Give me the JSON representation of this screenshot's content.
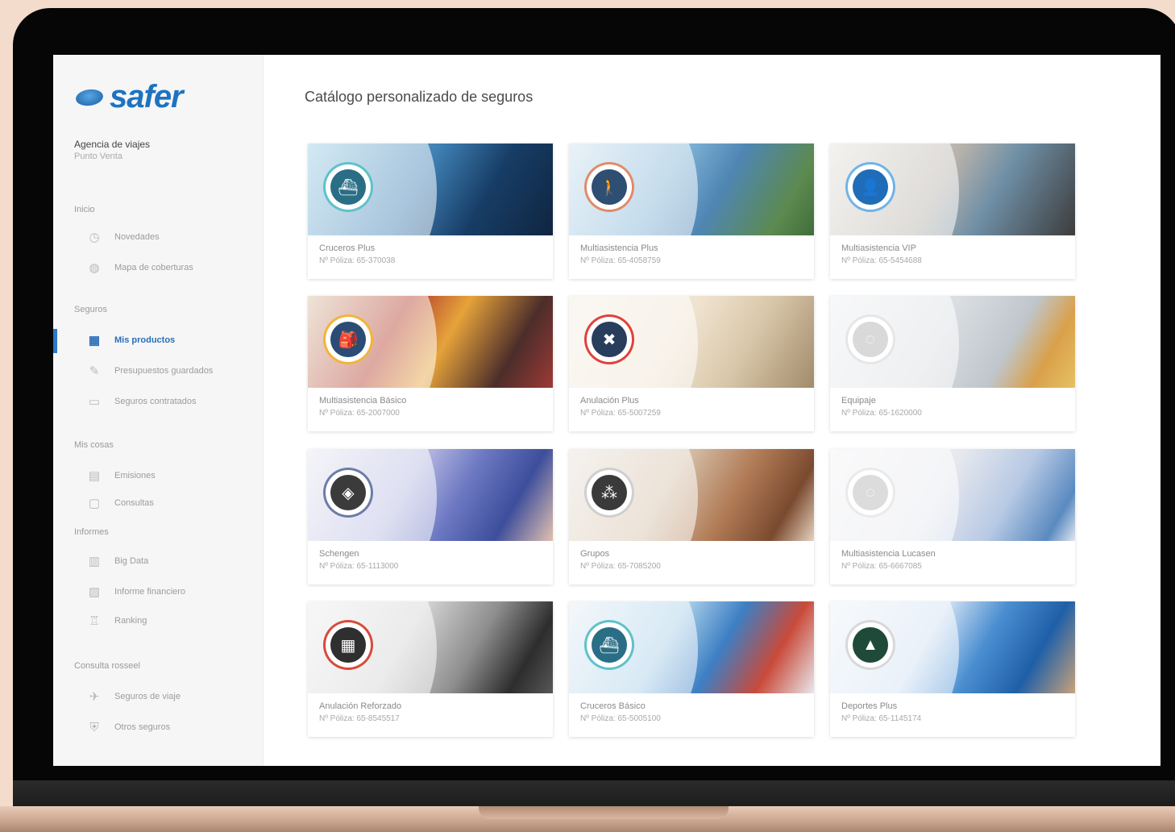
{
  "brand": {
    "name": "safer"
  },
  "agency": {
    "name": "Agencia de viajes",
    "subtitle": "Punto Venta"
  },
  "page_title": "Catálogo personalizado de seguros",
  "nav_sections": [
    {
      "title": "Inicio",
      "items": [
        {
          "label": "Novedades",
          "icon": "clock-icon",
          "glyph": "◷"
        },
        {
          "label": "Mapa de coberturas",
          "icon": "globe-icon",
          "glyph": "◍"
        }
      ]
    },
    {
      "title": "Seguros",
      "items": [
        {
          "label": "Mis productos",
          "icon": "products-icon",
          "glyph": "▦",
          "active": true
        },
        {
          "label": "Presupuestos guardados",
          "icon": "pen-icon",
          "glyph": "✎"
        },
        {
          "label": "Seguros contratados",
          "icon": "monitor-icon",
          "glyph": "▭"
        }
      ]
    },
    {
      "title": "Mis cosas",
      "items": [
        {
          "label": "Emisiones",
          "icon": "document-icon",
          "glyph": "▤"
        },
        {
          "label": "Consultas",
          "icon": "chat-icon",
          "glyph": "▢"
        }
      ]
    },
    {
      "title": "Informes",
      "items": [
        {
          "label": "Big Data",
          "icon": "grid-icon",
          "glyph": "▥"
        },
        {
          "label": "Informe financiero",
          "icon": "finance-icon",
          "glyph": "▨"
        },
        {
          "label": "Ranking",
          "icon": "trophy-icon",
          "glyph": "♖"
        }
      ]
    },
    {
      "title": "Consulta rosseel",
      "items": [
        {
          "label": "Seguros de viaje",
          "icon": "plane-icon",
          "glyph": "✈"
        },
        {
          "label": "Otros seguros",
          "icon": "shield-icon",
          "glyph": "⛨"
        }
      ]
    }
  ],
  "cards": [
    {
      "name": "Cruceros Plus",
      "policy": "Nº Póliza: 65-370038",
      "badge_icon": "ship-icon",
      "glyph": "⛴",
      "badge_color": "#2a6e86",
      "ring": "#5ec2c8",
      "photo": "linear-gradient(120deg,#9ed0e6 0%,#3f7fb3 45%,#173d66 70%,#0f2540 100%)"
    },
    {
      "name": "Multiasistencia Plus",
      "policy": "Nº Póliza: 65-4058759",
      "badge_icon": "hiker-icon",
      "glyph": "🚶",
      "badge_color": "#2e4e72",
      "ring": "#e28a6a",
      "photo": "linear-gradient(120deg,#cfe2ee 0%,#7fb2d6 40%,#4f86b3 60%,#5c8a4f 85%,#3f6e3a 100%)"
    },
    {
      "name": "Multiasistencia VIP",
      "policy": "Nº Póliza: 65-5454688",
      "badge_icon": "traveler-icon",
      "glyph": "👤",
      "badge_color": "#1f6cb8",
      "ring": "#6fb4e8",
      "photo": "linear-gradient(120deg,#e6e2dd 0%,#b7b2ab 45%,#6f8fa6 65%,#3c3c3c 100%)"
    },
    {
      "name": "Multiasistencia Básico",
      "policy": "Nº Póliza: 65-2007000",
      "badge_icon": "backpacker-icon",
      "glyph": "🎒",
      "badge_color": "#2b4c75",
      "ring": "#f2b43a",
      "photo": "linear-gradient(120deg,#d9c2a8 0%,#b3402f 35%,#e6a33a 55%,#4c2d2a 80%,#9c3a36 100%)"
    },
    {
      "name": "Anulación Plus",
      "policy": "Nº Póliza: 65-5007259",
      "badge_icon": "cancel-ticket-icon",
      "glyph": "✖",
      "badge_color": "#293e5c",
      "ring": "#e0423a",
      "photo": "linear-gradient(120deg,#f4ede4 0%,#efe3d0 45%,#d8c6a8 70%,#a18b6a 100%)"
    },
    {
      "name": "Equipaje",
      "policy": "Nº Póliza: 65-1620000",
      "badge_icon": "luggage-icon",
      "glyph": "◌",
      "badge_color": "#d9d9d9",
      "ring": "#e6e6e6",
      "photo": "linear-gradient(120deg,#eef0f2 0%,#d9dde1 45%,#bfc6cc 70%,#d9a04a 85%,#e7c163 100%)"
    },
    {
      "name": "Schengen",
      "policy": "Nº Póliza: 65-1113000",
      "badge_icon": "schengen-icon",
      "glyph": "◈",
      "badge_color": "#3b3b3b",
      "ring": "#6b7da8",
      "photo": "linear-gradient(120deg,#e8e7f2 0%,#b7b9e1 40%,#6c78c2 60%,#3d4e9c 80%,#e2c0b0 100%)"
    },
    {
      "name": "Grupos",
      "policy": "Nº Póliza: 65-7085200",
      "badge_icon": "group-icon",
      "glyph": "⁂",
      "badge_color": "#3a3a3a",
      "ring": "#cfcfcf",
      "photo": "linear-gradient(120deg,#e9e2da 0%,#d6c1aa 40%,#b07a55 65%,#7a4a2f 85%,#e7d3bf 100%)"
    },
    {
      "name": "Multiasistencia Lucasen",
      "policy": "Nº Póliza: 65-6667085",
      "badge_icon": "globe-badge-icon",
      "glyph": "◌",
      "badge_color": "#dcdcdc",
      "ring": "#eaeaea",
      "photo": "linear-gradient(120deg,#f3f3f4 0%,#e6e8ee 45%,#b7c9e4 70%,#5a8ac0 90%,#dfe6ef 100%)"
    },
    {
      "name": "Anulación Reforzado",
      "policy": "Nº Póliza: 65-8545517",
      "badge_icon": "calendar-icon",
      "glyph": "▦",
      "badge_color": "#2f2f2f",
      "ring": "#d84a3a",
      "photo": "linear-gradient(120deg,#eeeeee 0%,#d3d3d3 40%,#8e8e8e 65%,#2d2d2d 85%,#575757 100%)"
    },
    {
      "name": "Cruceros Básico",
      "policy": "Nº Póliza: 65-5005100",
      "badge_icon": "cruise-icon",
      "glyph": "⛴",
      "badge_color": "#2a6e86",
      "ring": "#5ec2c8",
      "photo": "linear-gradient(120deg,#e4eef5 0%,#a9cfe8 40%,#3d7fc4 60%,#c94a3a 80%,#e8e8ec 100%)"
    },
    {
      "name": "Deportes Plus",
      "policy": "Nº Póliza: 65-1145174",
      "badge_icon": "mountain-icon",
      "glyph": "▲",
      "badge_color": "#1f4a3a",
      "ring": "#d8d8d8",
      "photo": "linear-gradient(120deg,#eef3f8 0%,#cfe0f2 40%,#4b8fd1 60%,#1f5fa8 80%,#c7a27a 100%)"
    }
  ]
}
